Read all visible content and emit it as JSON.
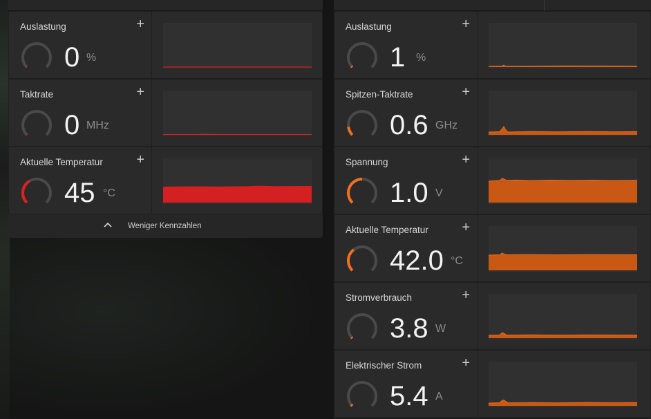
{
  "left": {
    "metrics": [
      {
        "title": "Auslastung",
        "value": "0",
        "unit": "%",
        "gauge_fraction": 0.0,
        "color": "#e02020"
      },
      {
        "title": "Taktrate",
        "value": "0",
        "unit": "MHz",
        "gauge_fraction": 0.0,
        "color": "#e02020"
      },
      {
        "title": "Aktuelle Temperatur",
        "value": "45",
        "unit": "°C",
        "gauge_fraction": 0.38,
        "color": "#e02020"
      }
    ],
    "footer_label": "Weniger Kennzahlen"
  },
  "right": {
    "metrics": [
      {
        "title": "Auslastung",
        "value": "1",
        "unit": "%",
        "gauge_fraction": 0.02,
        "color": "#f07020"
      },
      {
        "title": "Spitzen-Taktrate",
        "value": "0.6",
        "unit": "GHz",
        "gauge_fraction": 0.14,
        "color": "#f07020"
      },
      {
        "title": "Spannung",
        "value": "1.0",
        "unit": "V",
        "gauge_fraction": 0.5,
        "color": "#f07020"
      },
      {
        "title": "Aktuelle Temperatur",
        "value": "42.0",
        "unit": "°C",
        "gauge_fraction": 0.36,
        "color": "#f07020"
      },
      {
        "title": "Stromverbrauch",
        "value": "3.8",
        "unit": "W",
        "gauge_fraction": 0.02,
        "color": "#f07020"
      },
      {
        "title": "Elektrischer Strom",
        "value": "5.4",
        "unit": "A",
        "gauge_fraction": 0.03,
        "color": "#f07020"
      }
    ]
  },
  "add_icon": "plus-icon",
  "collapse_icon": "chevron-up-icon"
}
